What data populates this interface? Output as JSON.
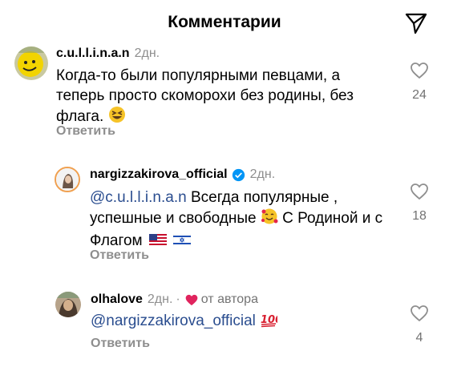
{
  "header": {
    "title": "Комментарии"
  },
  "comments": [
    {
      "username": "c.u.l.l.i.n.a.n",
      "time": "2дн.",
      "text": "Когда-то были популярными певцами, а теперь просто скоморохи без родины, без флага.",
      "emoji": "😆",
      "reply_label": "Ответить",
      "likes": "24"
    },
    {
      "username": "nargizzakirova_official",
      "time": "2дн.",
      "mention": "@c.u.l.l.i.n.a.n",
      "text_part1": "Всегда популярные , успешные  и свободные",
      "emoji": "🥰",
      "text_part2": "С Родиной и с Флагом",
      "reply_label": "Ответить",
      "likes": "18"
    },
    {
      "username": "olhalove",
      "time": "2дн.",
      "author_label": "от автора",
      "mention": "@nargizzakirova_official",
      "emoji": "💯",
      "reply_label": "Ответить",
      "likes": "4"
    }
  ],
  "colors": {
    "mention": "#2a4d8f",
    "muted": "#8e8e8e",
    "author_heart": "#e0245e",
    "verified": "#0095f6"
  }
}
